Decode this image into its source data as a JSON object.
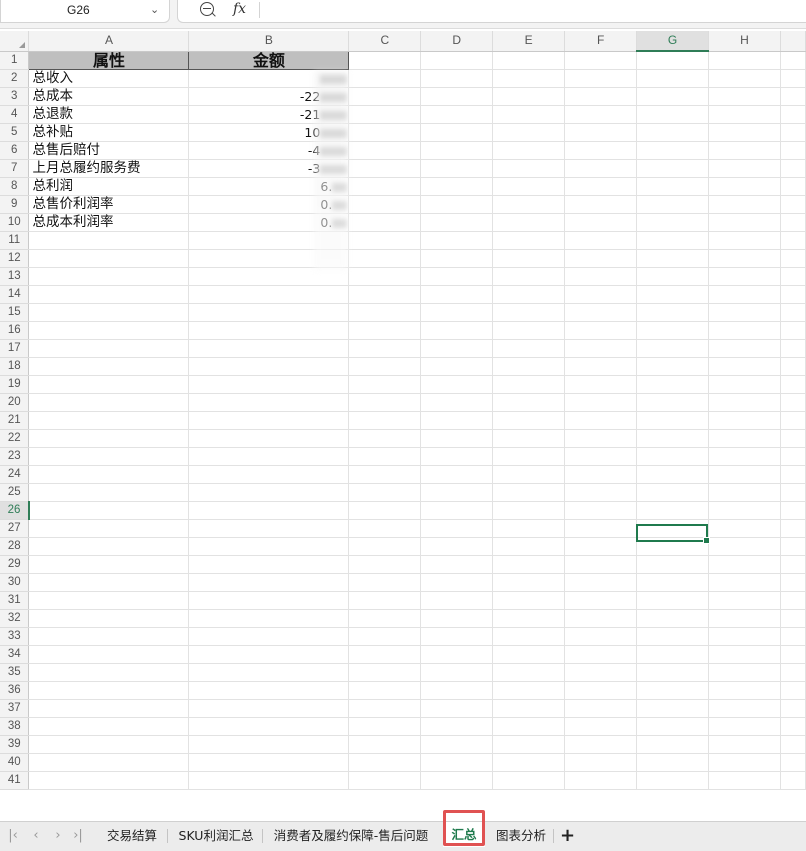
{
  "formula_bar": {
    "cell_ref": "G26",
    "fx_label": "fx"
  },
  "columns": [
    "A",
    "B",
    "C",
    "D",
    "E",
    "F",
    "G",
    "H"
  ],
  "rows": [
    "1",
    "2",
    "3",
    "4",
    "5",
    "6",
    "7",
    "8",
    "9",
    "10",
    "11",
    "12",
    "13",
    "14",
    "15",
    "16",
    "17",
    "18",
    "19",
    "20",
    "21",
    "22",
    "23",
    "24",
    "25",
    "26",
    "27",
    "28",
    "29",
    "30",
    "31",
    "32",
    "33",
    "34",
    "35",
    "36",
    "37",
    "38",
    "39",
    "40",
    "41"
  ],
  "header": {
    "col_a": "属性",
    "col_b": "金额"
  },
  "data_rows": [
    {
      "label": "总收入",
      "value": ""
    },
    {
      "label": "总成本",
      "value": "-22"
    },
    {
      "label": "总退款",
      "value": "-21"
    },
    {
      "label": "总补贴",
      "value": "10"
    },
    {
      "label": "总售后赔付",
      "value": "-4"
    },
    {
      "label": "上月总履约服务费",
      "value": "-3"
    },
    {
      "label": "总利润",
      "value": "6."
    },
    {
      "label": "总售价利润率",
      "value": "0."
    },
    {
      "label": "总成本利润率",
      "value": "0."
    }
  ],
  "sheet_tabs": [
    {
      "label": "交易结算"
    },
    {
      "label": "SKU利润汇总"
    },
    {
      "label": "消费者及履约保障-售后问题"
    },
    {
      "label": "汇总"
    },
    {
      "label": "图表分析"
    }
  ],
  "add_sheet_label": "+",
  "colors": {
    "accent": "#1f7a4d",
    "highlight": "#e05252",
    "header_fill": "#bfbfbf"
  }
}
